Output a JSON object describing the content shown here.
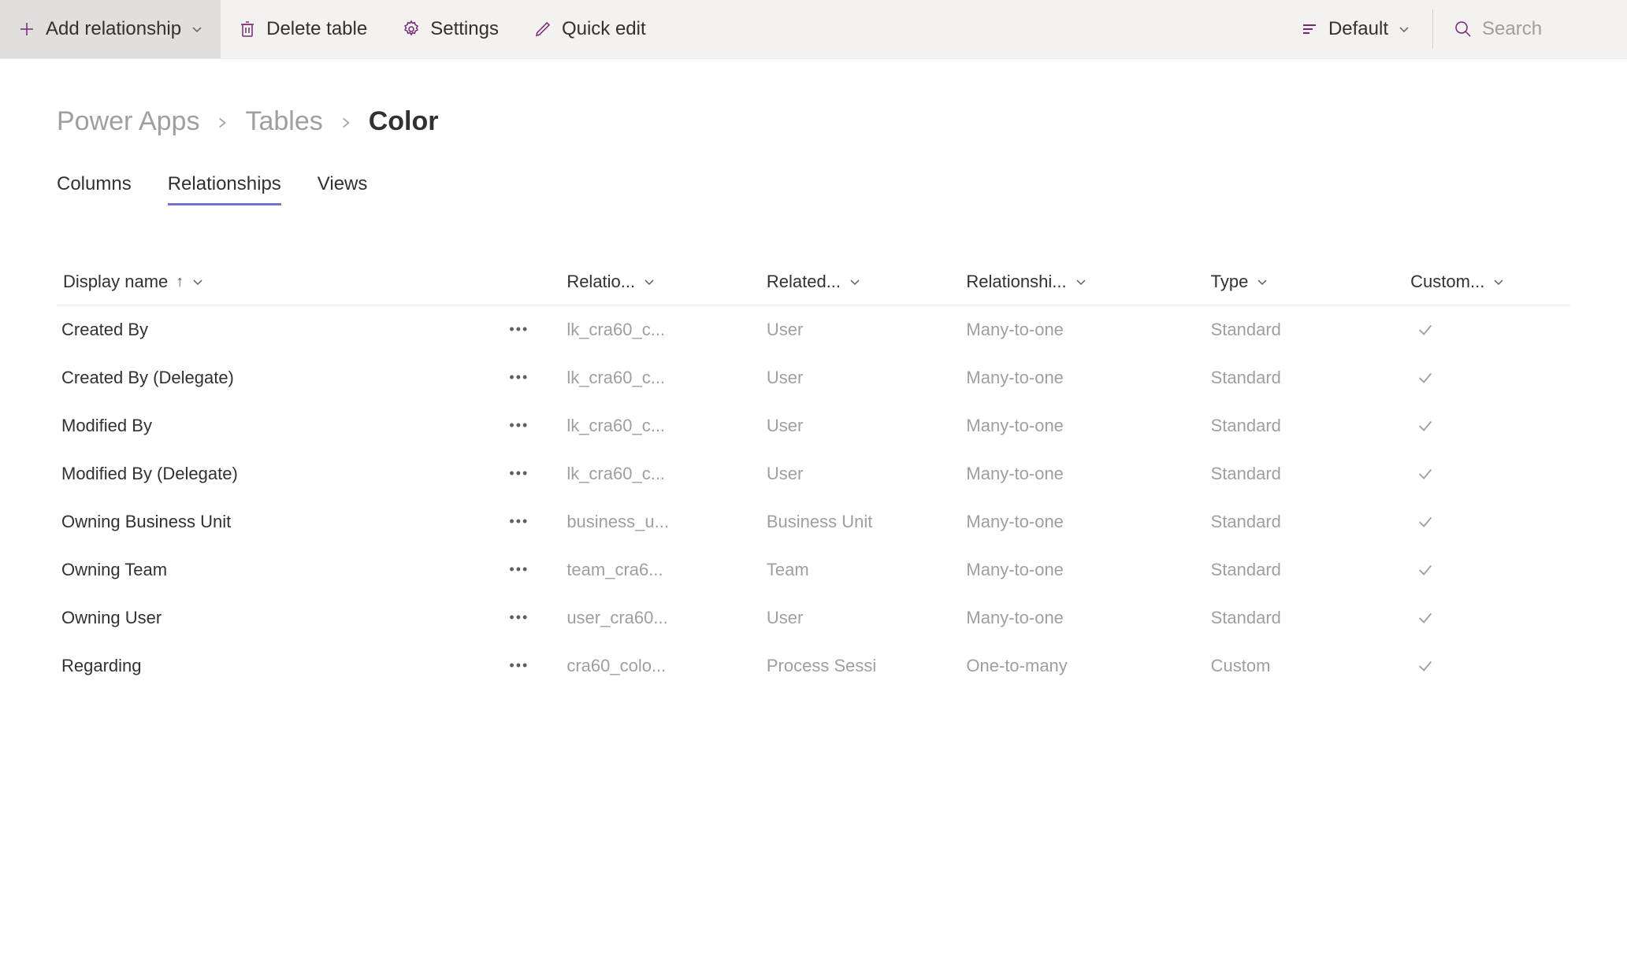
{
  "toolbar": {
    "add_label": "Add relationship",
    "delete_label": "Delete table",
    "settings_label": "Settings",
    "quickedit_label": "Quick edit",
    "view_label": "Default"
  },
  "search": {
    "placeholder": "Search"
  },
  "breadcrumb": {
    "root": "Power Apps",
    "level1": "Tables",
    "current": "Color"
  },
  "tabs": {
    "columns": "Columns",
    "relationships": "Relationships",
    "views": "Views"
  },
  "table": {
    "headers": {
      "display": "Display name",
      "relname": "Relatio...",
      "related": "Related...",
      "reltype": "Relationshi...",
      "type": "Type",
      "custom": "Custom..."
    },
    "rows": [
      {
        "display": "Created By",
        "relname": "lk_cra60_c...",
        "related": "User",
        "reltype": "Many-to-one",
        "type": "Standard",
        "custom": true
      },
      {
        "display": "Created By (Delegate)",
        "relname": "lk_cra60_c...",
        "related": "User",
        "reltype": "Many-to-one",
        "type": "Standard",
        "custom": true
      },
      {
        "display": "Modified By",
        "relname": "lk_cra60_c...",
        "related": "User",
        "reltype": "Many-to-one",
        "type": "Standard",
        "custom": true
      },
      {
        "display": "Modified By (Delegate)",
        "relname": "lk_cra60_c...",
        "related": "User",
        "reltype": "Many-to-one",
        "type": "Standard",
        "custom": true
      },
      {
        "display": "Owning Business Unit",
        "relname": "business_u...",
        "related": "Business Unit",
        "reltype": "Many-to-one",
        "type": "Standard",
        "custom": true
      },
      {
        "display": "Owning Team",
        "relname": "team_cra6...",
        "related": "Team",
        "reltype": "Many-to-one",
        "type": "Standard",
        "custom": true
      },
      {
        "display": "Owning User",
        "relname": "user_cra60...",
        "related": "User",
        "reltype": "Many-to-one",
        "type": "Standard",
        "custom": true
      },
      {
        "display": "Regarding",
        "relname": "cra60_colo...",
        "related": "Process Sessi",
        "reltype": "One-to-many",
        "type": "Custom",
        "custom": true
      }
    ]
  },
  "colors": {
    "accent": "#742774"
  }
}
